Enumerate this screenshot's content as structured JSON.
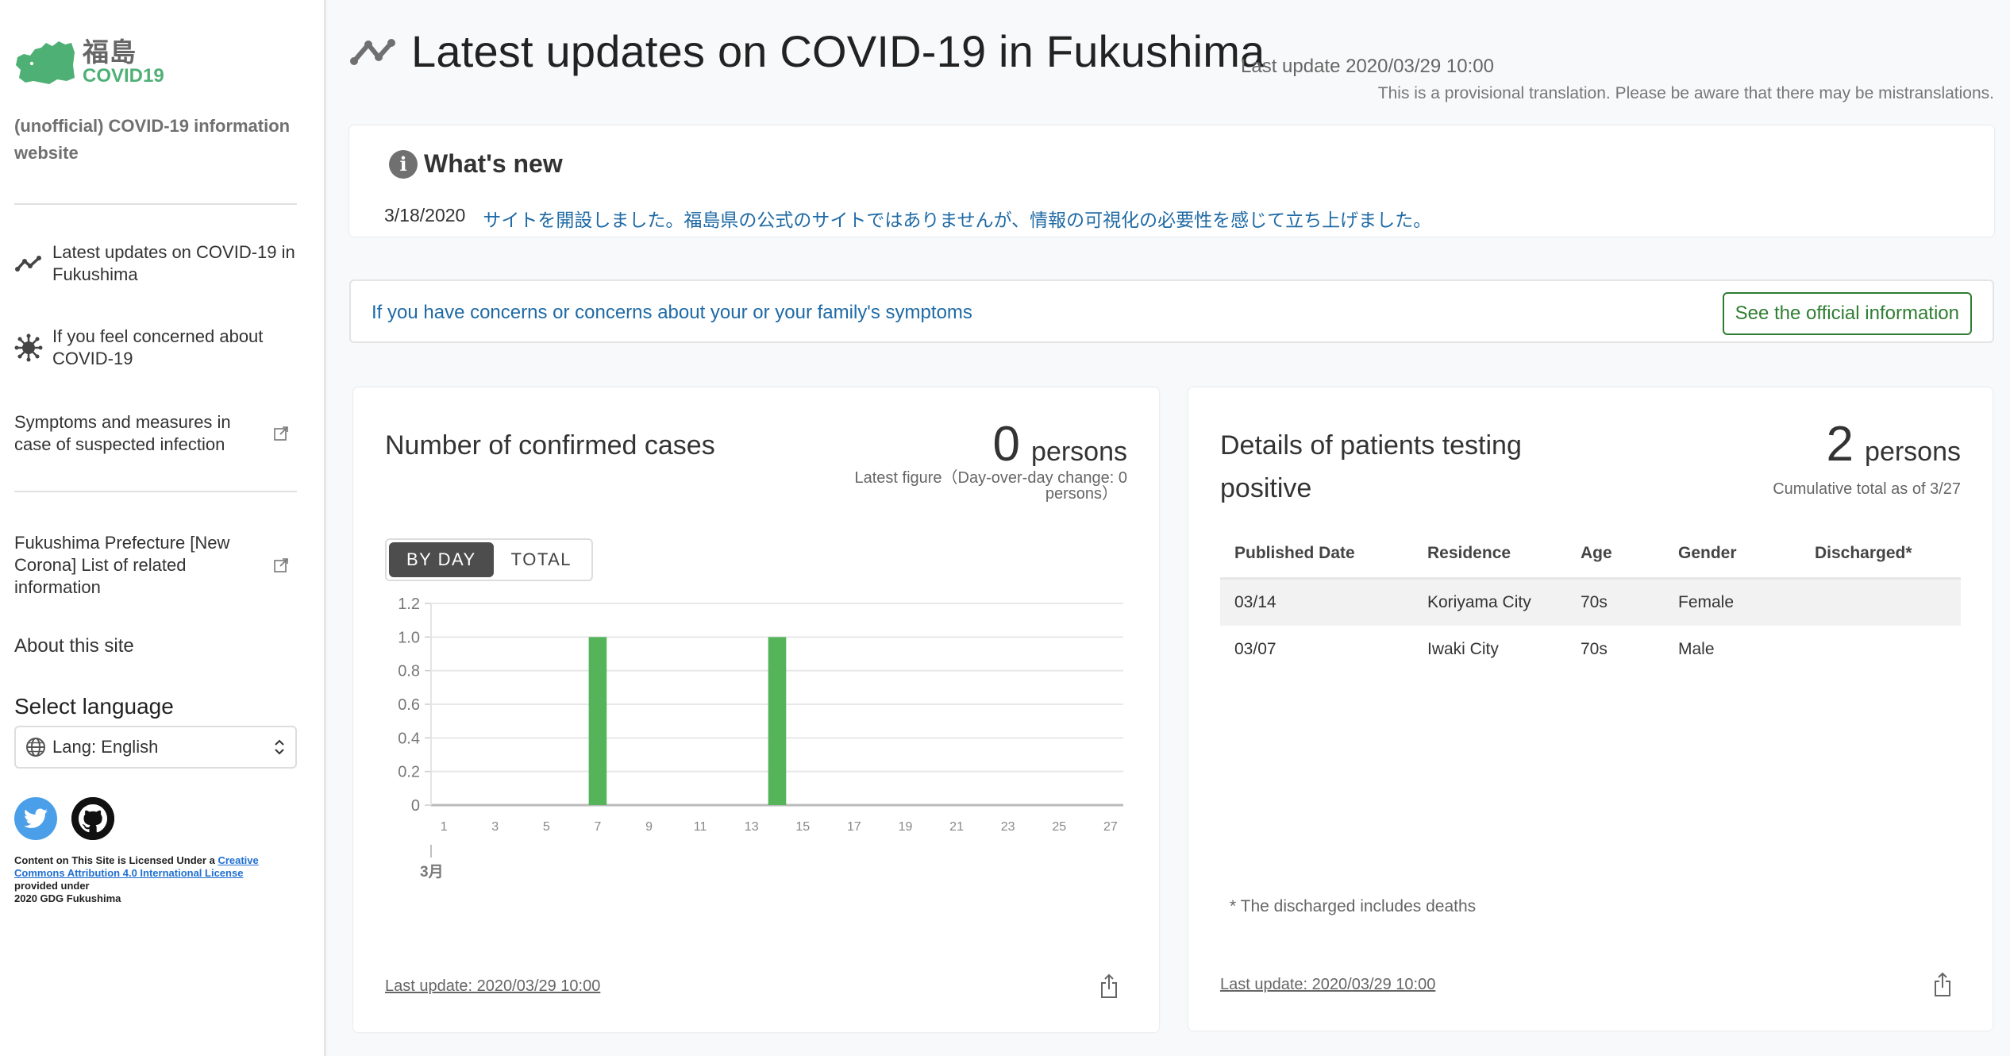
{
  "sidebar": {
    "logo": {
      "kanji": "福島",
      "subtitle": "COVID19",
      "color": "#4fb076"
    },
    "site_description": "(unofficial) COVID-19 information website",
    "nav_items": [
      {
        "label": "Latest updates on COVID-19 in Fukushima",
        "icon": "trend-chart-icon",
        "external": false
      },
      {
        "label": "If you feel concerned about COVID-19",
        "icon": "virus-icon",
        "external": false
      },
      {
        "label": "Symptoms and measures in case of suspected infection",
        "icon": "",
        "external": true
      },
      {
        "label": "Fukushima Prefecture [New Corona] List of related information",
        "icon": "",
        "external": true
      }
    ],
    "about_label": "About this site",
    "language": {
      "title": "Select language",
      "selected": "Lang: English"
    },
    "social": [
      "twitter-icon",
      "github-icon"
    ],
    "license": {
      "prefix": "Content on This Site is Licensed Under a ",
      "link_text": "Creative Commons Attribution 4.0 International License",
      "provided_under": "provided under",
      "owner": "2020 GDG Fukushima"
    }
  },
  "header": {
    "title": "Latest updates on COVID-19 in Fukushima",
    "last_update": "Last update 2020/03/29 10:00",
    "translation_note": "This is a provisional translation. Please be aware that there may be mistranslations."
  },
  "whats_new": {
    "title": "What's new",
    "items": [
      {
        "date": "3/18/2020",
        "text": "サイトを開設しました。福島県の公式のサイトではありませんが、情報の可視化の必要性を感じて立ち上げました。"
      }
    ]
  },
  "concerns": {
    "text": "If you have concerns or concerns about your or your family's symptoms",
    "button_label": "See the official information"
  },
  "confirmed_cases": {
    "title": "Number of confirmed cases",
    "value": "0",
    "unit": "persons",
    "note_line1": "Latest figure（Day-over-day change: 0",
    "note_line2": "persons）",
    "toggle": {
      "by_day": "BY DAY",
      "total": "TOTAL",
      "active": "by_day"
    },
    "last_update": "Last update: 2020/03/29 10:00"
  },
  "patients": {
    "title_line1": "Details of patients testing",
    "title_line2": "positive",
    "value": "2",
    "unit": "persons",
    "note": "Cumulative total as of 3/27",
    "columns": [
      "Published Date",
      "Residence",
      "Age",
      "Gender",
      "Discharged*"
    ],
    "rows": [
      [
        "03/14",
        "Koriyama City",
        "70s",
        "Female",
        ""
      ],
      [
        "03/07",
        "Iwaki City",
        "70s",
        "Male",
        ""
      ]
    ],
    "footnote": "* The discharged includes deaths",
    "last_update": "Last update: 2020/03/29 10:00"
  },
  "colors": {
    "bar": "#55b45a",
    "link": "#1f6aa5",
    "official_button": "#2e7d32"
  },
  "chart_data": {
    "type": "bar",
    "title": "Number of confirmed cases",
    "xlabel": "3月",
    "ylabel": "",
    "x": [
      1,
      2,
      3,
      4,
      5,
      6,
      7,
      8,
      9,
      10,
      11,
      12,
      13,
      14,
      15,
      16,
      17,
      18,
      19,
      20,
      21,
      22,
      23,
      24,
      25,
      26,
      27
    ],
    "x_tick_labels": [
      "1",
      "3",
      "5",
      "7",
      "9",
      "11",
      "13",
      "15",
      "17",
      "19",
      "21",
      "23",
      "25",
      "27"
    ],
    "values": [
      0,
      0,
      0,
      0,
      0,
      0,
      1,
      0,
      0,
      0,
      0,
      0,
      0,
      1,
      0,
      0,
      0,
      0,
      0,
      0,
      0,
      0,
      0,
      0,
      0,
      0,
      0
    ],
    "ylim": [
      0,
      1.2
    ],
    "y_ticks": [
      "0",
      "0.2",
      "0.4",
      "0.6",
      "0.8",
      "1.0",
      "1.2"
    ],
    "grid": true,
    "legend": "none"
  }
}
